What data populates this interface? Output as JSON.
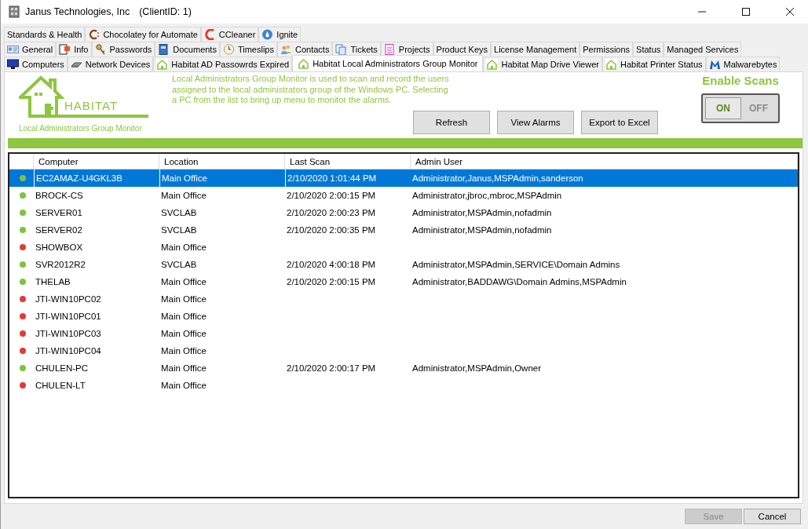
{
  "window": {
    "title": "Janus Technologies, Inc",
    "client_id": "(ClientID: 1)"
  },
  "tab_rows": [
    [
      {
        "label": "Standards & Health",
        "selected": false
      },
      {
        "label": "Chocolatey for Automate",
        "selected": false
      },
      {
        "label": "CCleaner",
        "selected": false
      },
      {
        "label": "Ignite",
        "selected": false
      }
    ],
    [
      {
        "label": "General",
        "selected": false
      },
      {
        "label": "Info",
        "selected": false
      },
      {
        "label": "Passwords",
        "selected": false
      },
      {
        "label": "Documents",
        "selected": false
      },
      {
        "label": "Timeslips",
        "selected": false
      },
      {
        "label": "Contacts",
        "selected": false
      },
      {
        "label": "Tickets",
        "selected": false
      },
      {
        "label": "Projects",
        "selected": false
      },
      {
        "label": "Product Keys",
        "selected": false
      },
      {
        "label": "License Management",
        "selected": false
      },
      {
        "label": "Permissions",
        "selected": false
      },
      {
        "label": "Status",
        "selected": false
      },
      {
        "label": "Managed Services",
        "selected": false
      }
    ],
    [
      {
        "label": "Computers",
        "selected": false
      },
      {
        "label": "Network Devices",
        "selected": false
      },
      {
        "label": "Habitat AD Passowrds Expired",
        "selected": false
      },
      {
        "label": "Habitat Local Administrators Group Monitor",
        "selected": true
      },
      {
        "label": "Habitat Map Drive Viewer",
        "selected": false
      },
      {
        "label": "Habitat Printer Status",
        "selected": false
      },
      {
        "label": "Malwarebytes",
        "selected": false
      }
    ]
  ],
  "logo": {
    "name": "HABITAT",
    "subtitle": "Local Administrators Group Monitor"
  },
  "description": "Local Administrators Group Monitor is used to scan and record the users assigned to the local administrators group of the Windows PC. Selecting a PC from the list to bring up menu to monitor the alarms.",
  "buttons": [
    "Refresh",
    "View Alarms",
    "Export to Excel"
  ],
  "enable_scans": {
    "title": "Enable Scans",
    "on_label": "ON",
    "off_label": "OFF",
    "on": true
  },
  "table": {
    "columns": [
      "Computer",
      "Location",
      "Last Scan",
      "Admin User"
    ],
    "rows": [
      {
        "color": "#7fc241",
        "computer": "EC2AMAZ-U4GKL3B",
        "location": "Main Office",
        "last_scan": "2/10/2020 1:01:44 PM",
        "admin_user": "Administrator,Janus,MSPAdmin,sanderson",
        "selected": true
      },
      {
        "color": "#7fc241",
        "computer": "BROCK-CS",
        "location": "Main Office",
        "last_scan": "2/10/2020 2:00:15 PM",
        "admin_user": "Administrator,jbroc,mbroc,MSPAdmin",
        "selected": false
      },
      {
        "color": "#7fc241",
        "computer": "SERVER01",
        "location": "SVCLAB",
        "last_scan": "2/10/2020 2:00:23 PM",
        "admin_user": "Administrator,MSPAdmin,nofadmin",
        "selected": false
      },
      {
        "color": "#7fc241",
        "computer": "SERVER02",
        "location": "SVCLAB",
        "last_scan": "2/10/2020 2:00:35 PM",
        "admin_user": "Administrator,MSPAdmin,nofadmin",
        "selected": false
      },
      {
        "color": "#e23a3a",
        "computer": "SHOWBOX",
        "location": "Main Office",
        "selected": false
      },
      {
        "color": "#7fc241",
        "computer": "SVR2012R2",
        "location": "SVCLAB",
        "last_scan": "2/10/2020 4:00:18 PM",
        "admin_user": "Administrator,MSPAdmin,SERVICE\\Domain Admins",
        "selected": false
      },
      {
        "color": "#7fc241",
        "computer": "THELAB",
        "location": "Main Office",
        "last_scan": "2/10/2020 2:00:15 PM",
        "admin_user": "Administrator,BADDAWG\\Domain Admins,MSPAdmin",
        "selected": false
      },
      {
        "color": "#e23a3a",
        "computer": "JTI-WIN10PC02",
        "location": "Main Office",
        "selected": false
      },
      {
        "color": "#e23a3a",
        "computer": "JTI-WIN10PC01",
        "location": "Main Office",
        "selected": false
      },
      {
        "color": "#e23a3a",
        "computer": "JTI-WIN10PC03",
        "location": "Main Office",
        "selected": false
      },
      {
        "color": "#e23a3a",
        "computer": "JTI-WIN10PC04",
        "location": "Main Office",
        "selected": false
      },
      {
        "color": "#7fc241",
        "computer": "CHULEN-PC",
        "location": "Main Office",
        "last_scan": "2/10/2020 2:00:17 PM",
        "admin_user": "Administrator,MSPAdmin,Owner",
        "selected": false
      },
      {
        "color": "#e23a3a",
        "computer": "CHULEN-LT",
        "location": "Main Office",
        "selected": false
      }
    ]
  },
  "footer_buttons": [
    {
      "label": "Save",
      "disabled": true
    },
    {
      "label": "Cancel",
      "disabled": false
    }
  ]
}
